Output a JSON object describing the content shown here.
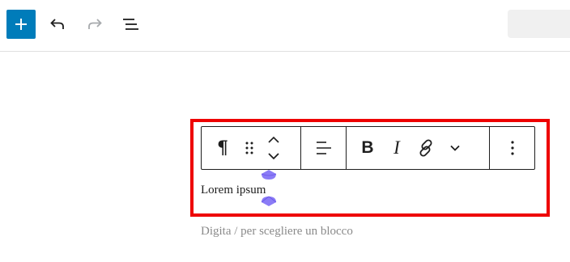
{
  "header": {
    "inserter_icon": "plus-icon",
    "undo_icon": "undo-icon",
    "redo_icon": "redo-icon",
    "list_view_icon": "list-view-icon",
    "accent_color": "#007cba"
  },
  "block_toolbar": {
    "block_type_glyph": "¶",
    "block_type_icon": "paragraph-icon",
    "drag_icon": "drag-handle-icon",
    "move_up_icon": "chevron-up-icon",
    "move_down_icon": "chevron-down-icon",
    "align_icon": "align-left-icon",
    "bold_label": "B",
    "italic_label": "I",
    "link_icon": "link-icon",
    "more_formats_icon": "chevron-down-icon",
    "options_icon": "more-vertical-icon"
  },
  "content": {
    "paragraph": "Lorem ipsum",
    "placeholder": "Digita / per scegliere un blocco"
  },
  "colors": {
    "highlight": "#ee0000",
    "selection_handle": "#7b68ee",
    "placeholder": "#8a8a8a"
  }
}
